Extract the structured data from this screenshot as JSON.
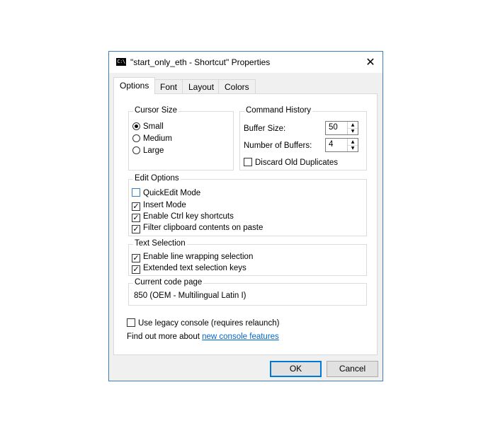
{
  "window": {
    "title": "\"start_only_eth - Shortcut\" Properties",
    "icon_text": "C:\\",
    "close_glyph": "✕"
  },
  "tabs": [
    {
      "label": "Options",
      "active": true
    },
    {
      "label": "Font",
      "active": false
    },
    {
      "label": "Layout",
      "active": false
    },
    {
      "label": "Colors",
      "active": false
    }
  ],
  "cursor_size": {
    "label": "Cursor Size",
    "options": [
      {
        "label": "Small",
        "selected": true
      },
      {
        "label": "Medium",
        "selected": false
      },
      {
        "label": "Large",
        "selected": false
      }
    ]
  },
  "command_history": {
    "label": "Command History",
    "buffer_size_label": "Buffer Size:",
    "buffer_size_value": "50",
    "num_buffers_label": "Number of Buffers:",
    "num_buffers_value": "4",
    "discard_label": "Discard Old Duplicates",
    "discard_checked": false
  },
  "edit_options": {
    "label": "Edit Options",
    "items": [
      {
        "label": "QuickEdit Mode",
        "checked": false
      },
      {
        "label": "Insert Mode",
        "checked": true
      },
      {
        "label": "Enable Ctrl key shortcuts",
        "checked": true
      },
      {
        "label": "Filter clipboard contents on paste",
        "checked": true
      }
    ]
  },
  "text_selection": {
    "label": "Text Selection",
    "items": [
      {
        "label": "Enable line wrapping selection",
        "checked": true
      },
      {
        "label": "Extended text selection keys",
        "checked": true
      }
    ]
  },
  "code_page": {
    "label": "Current code page",
    "value": "850   (OEM - Multilingual Latin I)"
  },
  "legacy": {
    "label": "Use legacy console (requires relaunch)",
    "checked": false,
    "find_out_text": "Find out more about ",
    "link_text": "new console features"
  },
  "buttons": {
    "ok": "OK",
    "cancel": "Cancel"
  },
  "colors": {
    "accent": "#0078d7",
    "window_border": "#3a7fc4",
    "link": "#0066cc"
  }
}
